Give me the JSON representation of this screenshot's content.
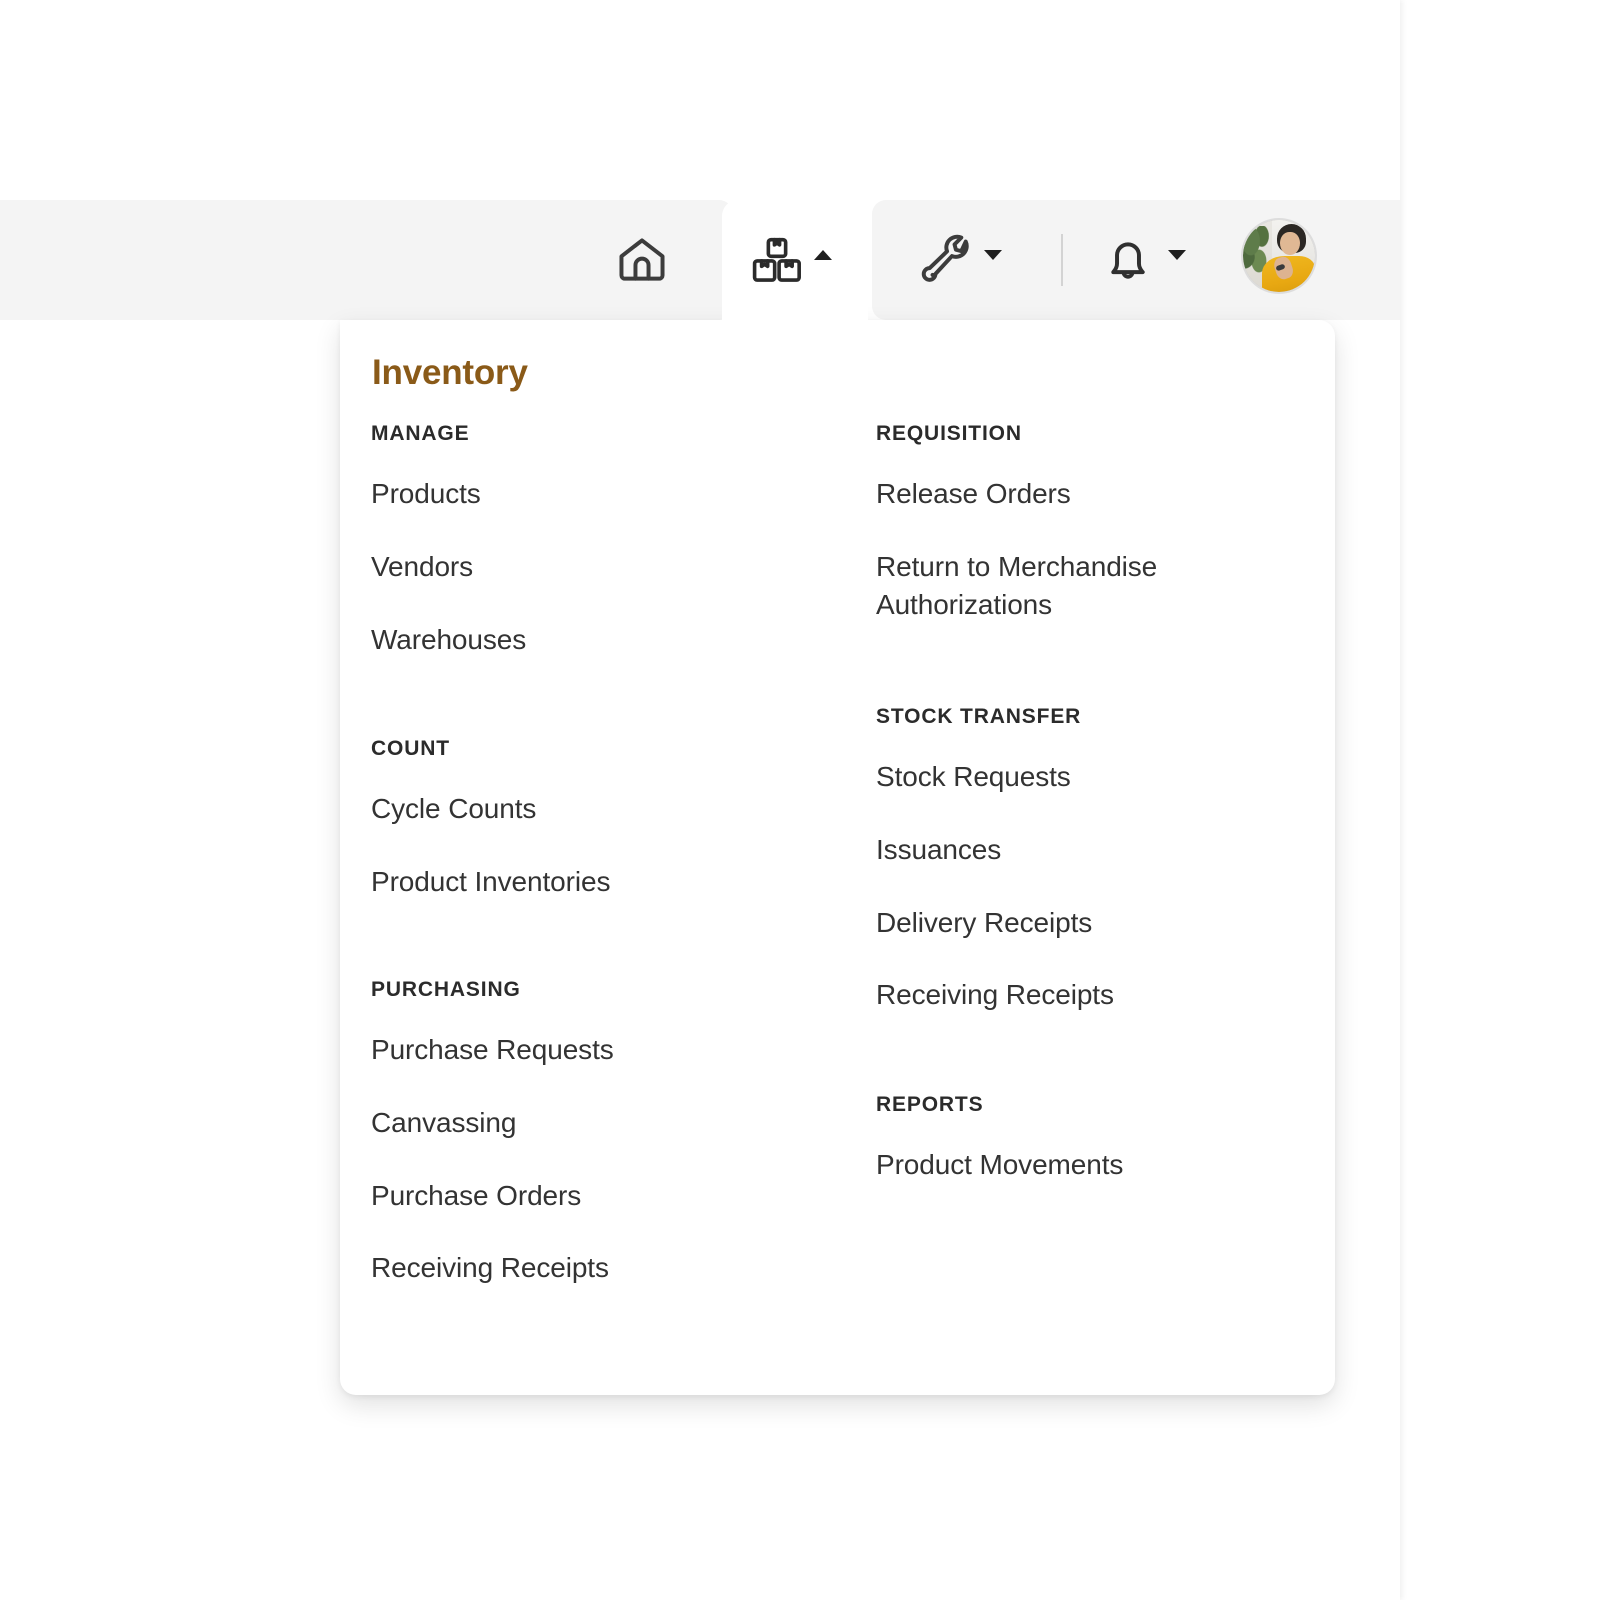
{
  "topbar": {
    "buttons": [
      {
        "name": "home",
        "icon": "home-icon",
        "label": "Home",
        "active": false,
        "caret": null
      },
      {
        "name": "inventory",
        "icon": "boxes-icon",
        "label": "Inventory",
        "active": true,
        "caret": "caret-up"
      },
      {
        "name": "tools",
        "icon": "wrench-icon",
        "label": "Tools",
        "active": false,
        "caret": "caret-down"
      },
      {
        "name": "notifications",
        "icon": "bell-icon",
        "label": "Notifications",
        "active": false,
        "caret": "caret-down"
      }
    ],
    "divider": true,
    "avatar": {
      "name": "user-avatar",
      "alt": "User profile photo"
    }
  },
  "menu": {
    "title": "Inventory",
    "accent_color": "#8a5a18",
    "columns": [
      {
        "key": "left",
        "sections": [
          {
            "heading": "MANAGE",
            "items": [
              "Products",
              "Vendors",
              "Warehouses"
            ]
          },
          {
            "heading": "COUNT",
            "items": [
              "Cycle Counts",
              "Product Inventories"
            ]
          },
          {
            "heading": "PURCHASING",
            "items": [
              "Purchase Requests",
              "Canvassing",
              "Purchase Orders",
              "Receiving Receipts"
            ]
          }
        ]
      },
      {
        "key": "right",
        "sections": [
          {
            "heading": "REQUISITION",
            "items": [
              "Release Orders",
              "Return to Merchandise Authorizations"
            ]
          },
          {
            "heading": "STOCK TRANSFER",
            "items": [
              "Stock Requests",
              "Issuances",
              "Delivery Receipts",
              "Receiving Receipts"
            ]
          },
          {
            "heading": "REPORTS",
            "items": [
              "Product Movements"
            ]
          }
        ]
      }
    ]
  }
}
